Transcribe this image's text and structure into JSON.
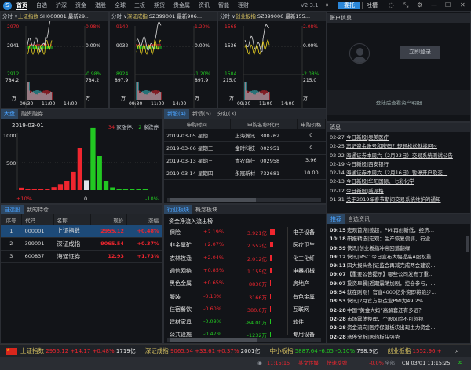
{
  "topbar": {
    "logo": "S",
    "menu": [
      "首页",
      "自选",
      "沪深",
      "资金",
      "港股",
      "全球",
      "三板",
      "期货",
      "贵金属",
      "资讯",
      "智能",
      "理财"
    ],
    "version": "V2.3.1",
    "entrust": "委托",
    "feedback": "吐槽"
  },
  "charts": [
    {
      "mode": "分时",
      "name": "上证指数",
      "code": "SH000001",
      "latest": "最新29...",
      "high": "2970",
      "mid": "2941",
      "low": "2912",
      "pct_high": "0.98%",
      "pct_mid": "0.00%",
      "pct_low": "-0.98%",
      "vol": "784.2",
      "unit": "万",
      "times": [
        "09:30",
        "11:00",
        "14:00"
      ]
    },
    {
      "mode": "分时",
      "name": "深证成指",
      "code": "SZ399001",
      "latest": "最新906...",
      "high": "9140",
      "mid": "9032",
      "low": "8924",
      "pct_high": "1.20%",
      "pct_mid": "0.00%",
      "pct_low": "-1.20%",
      "vol": "897.9",
      "unit": "万",
      "times": [
        "09:30",
        "11:00",
        "14:00"
      ]
    },
    {
      "mode": "分时",
      "name": "创业板指",
      "code": "SZ399006",
      "latest": "最新155...",
      "high": "1568",
      "mid": "1536",
      "low": "1504",
      "pct_high": "2.08%",
      "pct_mid": "0.00%",
      "pct_low": "-2.08%",
      "vol": "215.0",
      "unit": "万",
      "times": [
        "09:30",
        "11:00",
        "14:00"
      ]
    }
  ],
  "market": {
    "tabs": [
      "大盘",
      "融资融券"
    ],
    "date": "2019-03-01",
    "up_limit": "34",
    "up_text": "家涨停、",
    "down_limit": "2",
    "down_text": "家跌停",
    "y_ticks": [
      "1000",
      "500"
    ],
    "x_ticks": [
      "+10%",
      "0",
      "-10%"
    ],
    "chart_data": {
      "type": "bar",
      "title": "涨跌分布",
      "categories": [
        "+10%",
        "+9%",
        "+8%",
        "+7%",
        "+6%",
        "+5%",
        "+4%",
        "+3%",
        "+2%",
        "+1%",
        "0",
        "-1%",
        "-2%",
        "-3%",
        "-4%",
        "-5%",
        "-6%",
        "-7%",
        "-8%",
        "-9%"
      ],
      "values": [
        45,
        10,
        12,
        18,
        20,
        55,
        110,
        160,
        330,
        760,
        180,
        1130,
        620,
        170,
        50,
        10,
        8,
        8,
        6,
        6
      ],
      "ylim": [
        0,
        1150
      ]
    }
  },
  "ipo": {
    "tabs": [
      "新股(4)",
      "新债(6)",
      "分红(3)"
    ],
    "headers": [
      "申购时间",
      "申购名称/代码",
      "申购价格"
    ],
    "rows": [
      [
        "2019-03-05 星期二",
        "上海瀚讯",
        "300762",
        "0"
      ],
      [
        "2019-03-06 星期三",
        "金时科技",
        "002951",
        "0"
      ],
      [
        "2019-03-13 星期三",
        "青农商行",
        "002958",
        "3.96"
      ],
      [
        "2019-03-14 星期四",
        "永冠新材",
        "732681",
        "10.00"
      ]
    ]
  },
  "account": {
    "title": "账户信息",
    "login": "立即登录",
    "hint": "登陆后查看资产明细"
  },
  "messages": {
    "title": "消息",
    "items": [
      [
        "02-27",
        "今日新股|奥美医疗"
      ],
      [
        "02-25",
        "忘记资金账号和密码？轻轻松松就找回~"
      ],
      [
        "02-22",
        "海通证券本周六（2月23日）交易系统测试公告"
      ],
      [
        "02-19",
        "今日新股|西安银行"
      ],
      [
        "02-14",
        "海通证券本周六（2月16日）暂停开户及交..."
      ],
      [
        "02-13",
        "今日新股|华阳国际、七彩化学"
      ],
      [
        "02-12",
        "今日新股|威派格"
      ],
      [
        "01-31",
        "关于2019年春节期间交易系统维护的通知"
      ]
    ]
  },
  "news": {
    "tabs": [
      "推荐",
      "自选资讯"
    ],
    "items": [
      [
        "09:15",
        "宏观首席|姜超：PMI再创新低，经济…"
      ],
      [
        "10:18",
        "研报精选|宏观：生产恢复偏弱，行业…"
      ],
      [
        "09:59",
        "快讯|创业板指冲高回落翻绿"
      ],
      [
        "09:12",
        "快讯|MSCI今日宣布大幅提高A股权重"
      ],
      [
        "09:11",
        "四大报头条|证监会再减完成两会建议…"
      ],
      [
        "09:07",
        "【重要公告提示】哪些公司发布了重…"
      ],
      [
        "09:07",
        "投资早餐|近期震荡加剧，控仓参与，…"
      ],
      [
        "06:54",
        "就在刚刚！官宣4000亿外资即将跑步…"
      ],
      [
        "08:53",
        "快讯|2月官方制造业PMI为49.2%"
      ],
      [
        "02-28",
        "中国“黄金大妈”高解套还有多远？"
      ],
      [
        "02-28",
        "市场震荡整理，个股风险不可忽视"
      ],
      [
        "02-28",
        "资金流向|医疗保健板块出现主力资金…"
      ],
      [
        "02-28",
        "涨停分析|医药板块强势"
      ]
    ]
  },
  "watchlist": {
    "tabs": [
      "自选股",
      "我的持仓"
    ],
    "headers": [
      "序号",
      "代码",
      "名称",
      "现价",
      "涨幅"
    ],
    "rows": [
      [
        "1",
        "000001",
        "上证指数",
        "2955.12",
        "+0.48%"
      ],
      [
        "2",
        "399001",
        "深证成指",
        "9065.54",
        "+0.37%"
      ],
      [
        "3",
        "600837",
        "海通证券",
        "12.93",
        "+1.73%"
      ]
    ]
  },
  "sectors": {
    "tabs": [
      "行业板块",
      "概念板块"
    ],
    "subtitle": "资金净流入流出榜",
    "rows": [
      [
        "保险",
        "+2.19%",
        "3.921亿",
        1.0
      ],
      [
        "非金属矿",
        "+2.07%",
        "2.552亿",
        0.65
      ],
      [
        "农林牧渔",
        "+2.04%",
        "2.012亿",
        0.5
      ],
      [
        "通信网络",
        "+0.85%",
        "1.155亿",
        0.3
      ],
      [
        "黑色金属",
        "+0.65%",
        "8830万",
        0.2
      ],
      [
        "服装",
        "-0.10%",
        "3166万",
        0.1
      ],
      [
        "住宿餐饮",
        "-0.60%",
        "380.0万",
        0.08
      ],
      [
        "建材家具",
        "-0.09%",
        "-84.00万",
        -0.05
      ],
      [
        "公共设施",
        "-0.47%",
        "-1232万",
        -0.1
      ]
    ],
    "right": [
      "电子设备",
      "医疗卫生",
      "化工化纤",
      "电器机械",
      "房地产",
      "有色金属",
      "互联网",
      "软件",
      "专用设备"
    ]
  },
  "ticker": [
    [
      "上证指数",
      "2955.12",
      "+14.17",
      "+0.48%",
      "1719亿"
    ],
    [
      "深证成指",
      "9065.54",
      "+33.61",
      "+0.37%",
      "2001亿"
    ],
    [
      "中小板指",
      "5887.64",
      "-6.05",
      "-0.10%",
      "798.9亿"
    ],
    [
      "创业板指",
      "1552.96",
      "+",
      ""
    ]
  ],
  "status": {
    "time": "11:15:15",
    "stock": "某文传媒",
    "event": "快速反弹",
    "pct": "-0.0%",
    "all": "全部",
    "clock": "CN 03/01 11:15:25"
  },
  "colors": {
    "up": "#f0262f",
    "down": "#22c822",
    "accent": "#2a86d8"
  }
}
